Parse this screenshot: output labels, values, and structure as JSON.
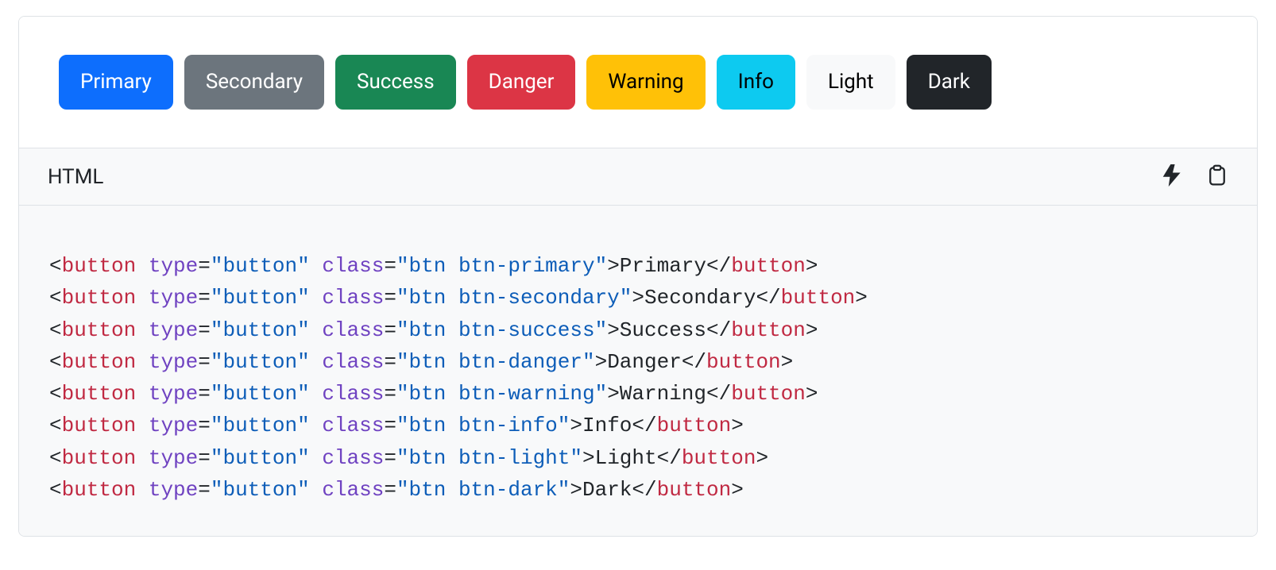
{
  "buttons": [
    {
      "label": "Primary",
      "variant": "primary"
    },
    {
      "label": "Secondary",
      "variant": "secondary"
    },
    {
      "label": "Success",
      "variant": "success"
    },
    {
      "label": "Danger",
      "variant": "danger"
    },
    {
      "label": "Warning",
      "variant": "warning"
    },
    {
      "label": "Info",
      "variant": "info"
    },
    {
      "label": "Light",
      "variant": "light"
    },
    {
      "label": "Dark",
      "variant": "dark"
    }
  ],
  "code_header": {
    "language": "HTML"
  },
  "code_lines": [
    {
      "tag": "button",
      "attrs": [
        {
          "name": "type",
          "value": "button"
        },
        {
          "name": "class",
          "value": "btn btn-primary"
        }
      ],
      "text": "Primary"
    },
    {
      "tag": "button",
      "attrs": [
        {
          "name": "type",
          "value": "button"
        },
        {
          "name": "class",
          "value": "btn btn-secondary"
        }
      ],
      "text": "Secondary"
    },
    {
      "tag": "button",
      "attrs": [
        {
          "name": "type",
          "value": "button"
        },
        {
          "name": "class",
          "value": "btn btn-success"
        }
      ],
      "text": "Success"
    },
    {
      "tag": "button",
      "attrs": [
        {
          "name": "type",
          "value": "button"
        },
        {
          "name": "class",
          "value": "btn btn-danger"
        }
      ],
      "text": "Danger"
    },
    {
      "tag": "button",
      "attrs": [
        {
          "name": "type",
          "value": "button"
        },
        {
          "name": "class",
          "value": "btn btn-warning"
        }
      ],
      "text": "Warning"
    },
    {
      "tag": "button",
      "attrs": [
        {
          "name": "type",
          "value": "button"
        },
        {
          "name": "class",
          "value": "btn btn-info"
        }
      ],
      "text": "Info"
    },
    {
      "tag": "button",
      "attrs": [
        {
          "name": "type",
          "value": "button"
        },
        {
          "name": "class",
          "value": "btn btn-light"
        }
      ],
      "text": "Light"
    },
    {
      "tag": "button",
      "attrs": [
        {
          "name": "type",
          "value": "button"
        },
        {
          "name": "class",
          "value": "btn btn-dark"
        }
      ],
      "text": "Dark"
    }
  ]
}
